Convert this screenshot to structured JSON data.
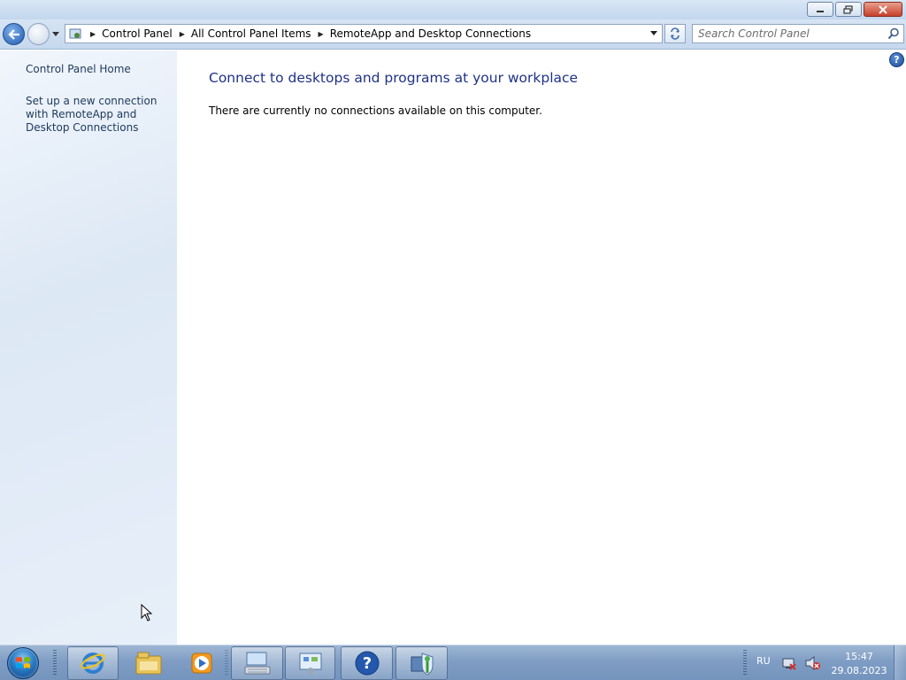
{
  "window": {
    "buttons": {
      "minimize": "minimize",
      "restore": "restore",
      "close": "close"
    }
  },
  "nav": {
    "breadcrumbs": [
      "Control Panel",
      "All Control Panel Items",
      "RemoteApp and Desktop Connections"
    ],
    "search_placeholder": "Search Control Panel"
  },
  "sidebar": {
    "home_label": "Control Panel Home",
    "setup_label": "Set up a new connection with RemoteApp and Desktop Connections"
  },
  "main": {
    "heading": "Connect to desktops and programs at your workplace",
    "message": "There are currently no connections available on this computer.",
    "help_glyph": "?"
  },
  "taskbar": {
    "pinned": [
      "internet-explorer-icon",
      "file-explorer-icon",
      "media-player-icon",
      "keyboard-settings-icon",
      "control-panel-icon",
      "help-icon",
      "network-security-icon"
    ],
    "language": "RU",
    "time": "15:47",
    "date": "29.08.2023"
  },
  "colors": {
    "heading": "#1e3287",
    "link": "#1e395b",
    "sidebar_bg": "#e7eff9",
    "taskbar": "#7f9dc4"
  }
}
